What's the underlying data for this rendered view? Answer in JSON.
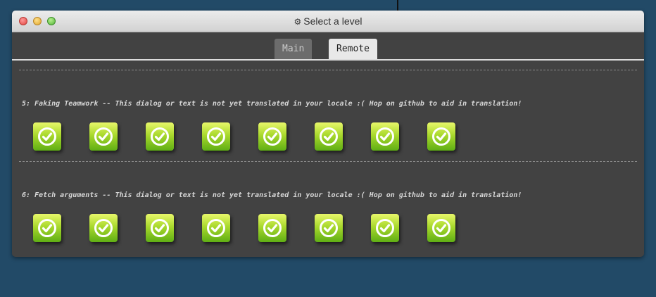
{
  "window": {
    "title_icon": "gear-icon",
    "title": "Select a level"
  },
  "tabs": [
    {
      "label": "Main",
      "active": false
    },
    {
      "label": "Remote",
      "active": true
    }
  ],
  "sequences": [
    {
      "title": "5: Faking Teamwork -- This dialog or text is not yet translated in your locale :( Hop on github to aid in translation!",
      "levels": [
        {
          "icon": "checkmark-icon",
          "completed": true
        },
        {
          "icon": "checkmark-icon",
          "completed": true
        },
        {
          "icon": "checkmark-icon",
          "completed": true
        },
        {
          "icon": "checkmark-icon",
          "completed": true
        },
        {
          "icon": "checkmark-icon",
          "completed": true
        },
        {
          "icon": "checkmark-icon",
          "completed": true
        },
        {
          "icon": "checkmark-icon",
          "completed": true
        },
        {
          "icon": "checkmark-icon",
          "completed": true
        }
      ]
    },
    {
      "title": "6: Fetch arguments -- This dialog or text is not yet translated in your locale :( Hop on github to aid in translation!",
      "levels": [
        {
          "icon": "checkmark-icon",
          "completed": true
        },
        {
          "icon": "checkmark-icon",
          "completed": true
        },
        {
          "icon": "checkmark-icon",
          "completed": true
        },
        {
          "icon": "checkmark-icon",
          "completed": true
        },
        {
          "icon": "checkmark-icon",
          "completed": true
        },
        {
          "icon": "checkmark-icon",
          "completed": true
        },
        {
          "icon": "checkmark-icon",
          "completed": true
        },
        {
          "icon": "checkmark-icon",
          "completed": true
        }
      ]
    }
  ],
  "colors": {
    "desktop": "#224a67",
    "panel": "#424242",
    "level_complete_top": "#e8f76a",
    "level_complete_bottom": "#5fae14"
  }
}
